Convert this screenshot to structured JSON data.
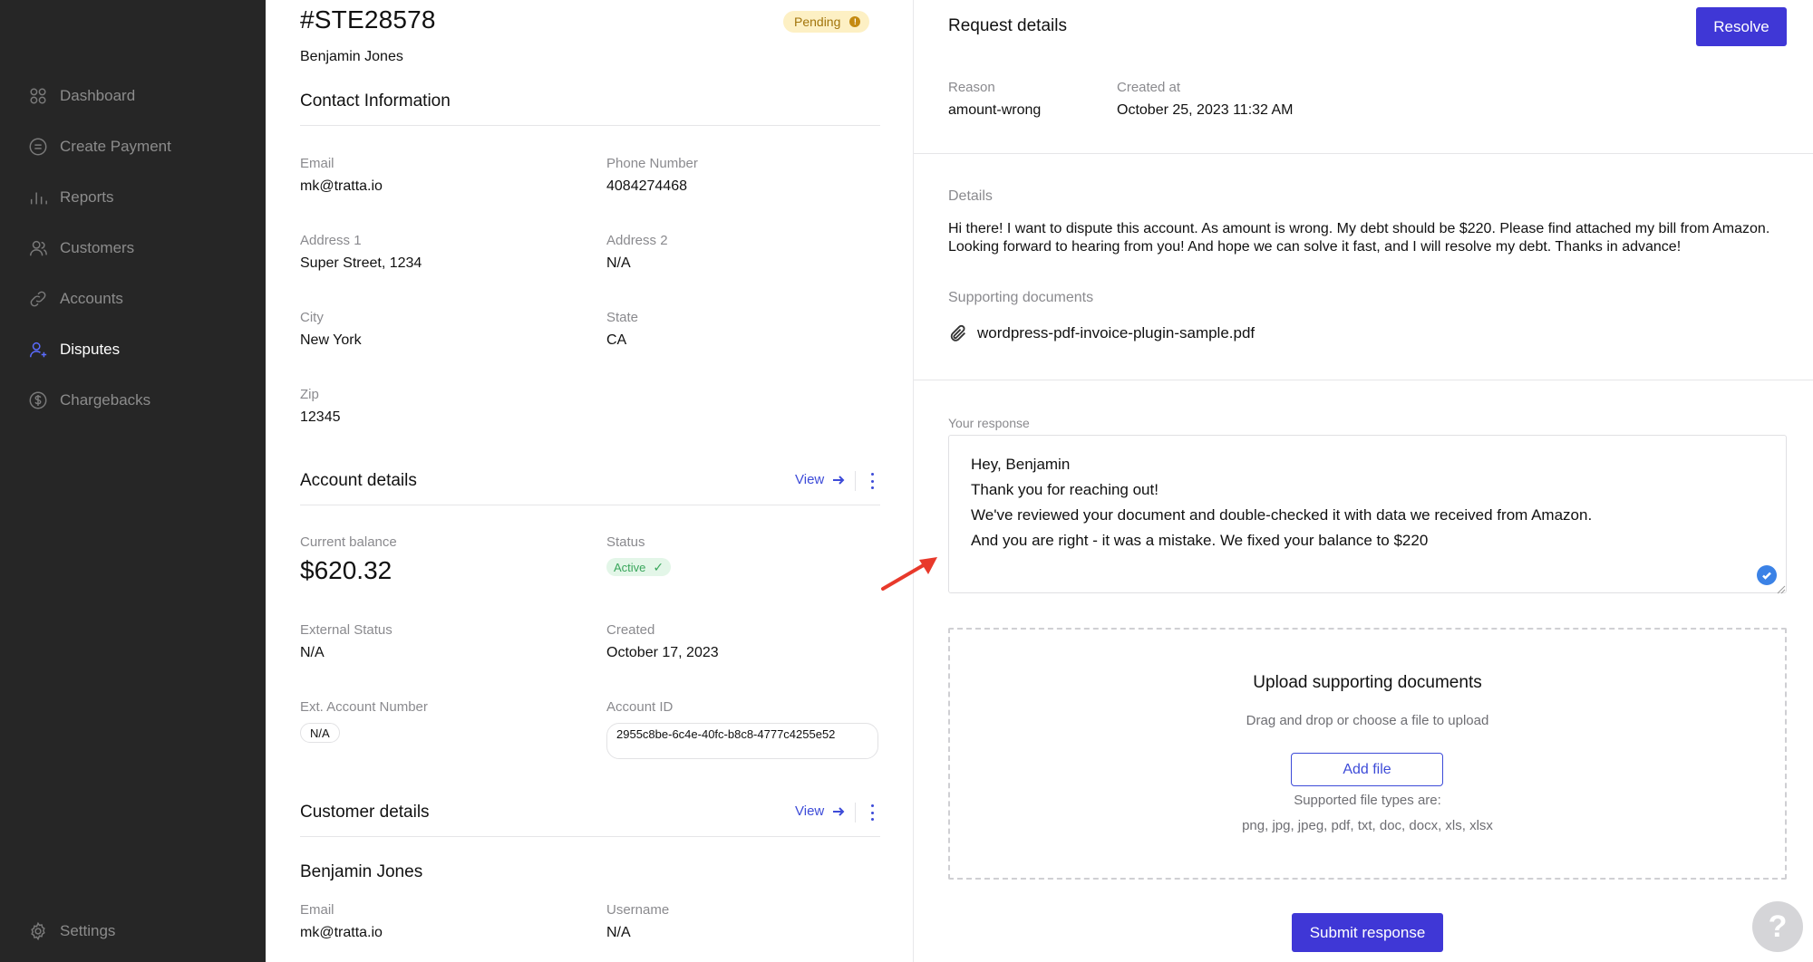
{
  "sidebar": {
    "items": [
      {
        "label": "Dashboard",
        "icon": "dashboard-icon",
        "active": false
      },
      {
        "label": "Create Payment",
        "icon": "payment-icon",
        "active": false
      },
      {
        "label": "Reports",
        "icon": "reports-icon",
        "active": false
      },
      {
        "label": "Customers",
        "icon": "customers-icon",
        "active": false
      },
      {
        "label": "Accounts",
        "icon": "link-icon",
        "active": false
      },
      {
        "label": "Disputes",
        "icon": "user-plus-icon",
        "active": true
      },
      {
        "label": "Chargebacks",
        "icon": "dollar-circle-icon",
        "active": false
      }
    ],
    "settings_label": "Settings"
  },
  "dispute": {
    "id": "#STE28578",
    "status": "Pending",
    "person_name": "Benjamin Jones"
  },
  "contact": {
    "title": "Contact Information",
    "email_label": "Email",
    "email": "mk@tratta.io",
    "phone_label": "Phone Number",
    "phone": "4084274468",
    "address1_label": "Address 1",
    "address1": "Super Street, 1234",
    "address2_label": "Address 2",
    "address2": "N/A",
    "city_label": "City",
    "city": "New York",
    "state_label": "State",
    "state": "CA",
    "zip_label": "Zip",
    "zip": "12345"
  },
  "account": {
    "title": "Account details",
    "view_label": "View",
    "balance_label": "Current balance",
    "balance": "$620.32",
    "status_label": "Status",
    "status": "Active",
    "external_status_label": "External Status",
    "external_status": "N/A",
    "created_label": "Created",
    "created": "October 17, 2023",
    "ext_account_label": "Ext. Account Number",
    "ext_account": "N/A",
    "account_id_label": "Account ID",
    "account_id": "2955c8be-6c4e-40fc-b8c8-4777c4255e52"
  },
  "customer": {
    "title": "Customer details",
    "view_label": "View",
    "name": "Benjamin Jones",
    "email_label": "Email",
    "email": "mk@tratta.io",
    "username_label": "Username",
    "username": "N/A"
  },
  "request": {
    "title": "Request details",
    "resolve_label": "Resolve",
    "reason_label": "Reason",
    "reason": "amount-wrong",
    "created_at_label": "Created at",
    "created_at": "October 25, 2023 11:32 AM",
    "details_label": "Details",
    "details": "Hi there! I want to dispute this account. As amount is wrong. My debt should be $220. Please find attached my bill from Amazon. Looking forward to hearing from you! And hope we can solve it fast, and I will resolve my debt. Thanks in advance!",
    "supporting_label": "Supporting documents",
    "document": "wordpress-pdf-invoice-plugin-sample.pdf"
  },
  "response": {
    "label": "Your response",
    "lines": [
      "Hey, Benjamin",
      "Thank you for reaching out!",
      "We've reviewed your document and double-checked it with data we received from Amazon.",
      "And you are right - it was a mistake. We fixed your balance to $220"
    ]
  },
  "upload": {
    "title": "Upload supporting documents",
    "subtitle": "Drag and drop or choose a file to upload",
    "add_file_label": "Add file",
    "types_label": "Supported file types are:",
    "types": "png, jpg, jpeg, pdf, txt, doc, docx, xls, xlsx"
  },
  "submit_label": "Submit response",
  "help_label": "?",
  "colors": {
    "sidebar_bg": "#262626",
    "accent": "#3f37d6",
    "pending_bg": "#fdf0c4",
    "active_green": "#3aa65c",
    "annotation_arrow": "#e8392b"
  }
}
